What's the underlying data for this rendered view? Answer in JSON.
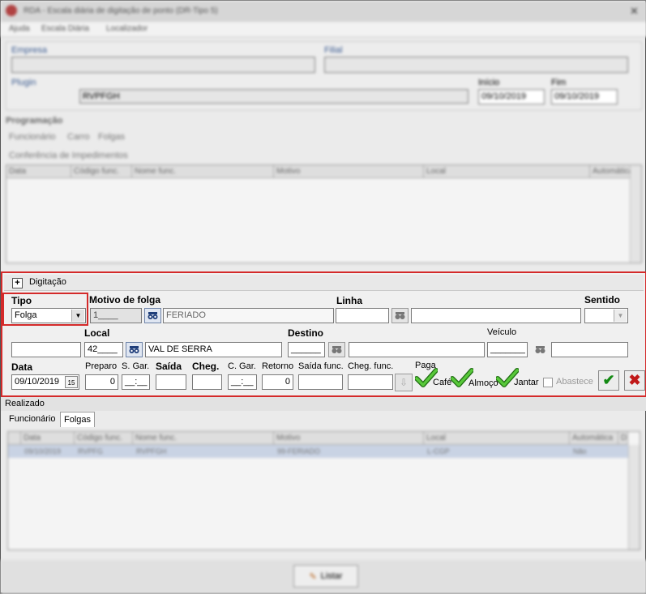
{
  "window": {
    "title": "RDA - Escala diária de digitação de ponto (DR-Tipo 5)",
    "menu": [
      "Ajuda",
      "Escala Diária",
      "Localizador"
    ]
  },
  "top": {
    "labels": [
      "Empresa",
      "Filial",
      "Plugin",
      "Início",
      "Fim"
    ],
    "values": [
      "RVPFGH",
      "09/10/2019",
      "09/10/2019"
    ]
  },
  "programacao": {
    "section_label": "Programação",
    "toggles": [
      "Funcionário",
      "Carro",
      "Folgas",
      "Conferência de Impedimentos"
    ],
    "grid_headers": [
      "Data",
      "Código func.",
      "Nome func.",
      "Motivo",
      "Local",
      "Automática"
    ]
  },
  "digitacao": {
    "header": "Digitação",
    "expand": "+",
    "tipo_label": "Tipo",
    "tipo_value": "Folga",
    "motivo_label": "Motivo de folga",
    "motivo_code": "1____",
    "motivo_desc": "FERIADO",
    "linha_label": "Linha",
    "sentido_label": "Sentido",
    "local_label": "Local",
    "local_code": "42____",
    "local_desc": "VAL DE SERRA",
    "destino_label": "Destino",
    "destino_code": "______",
    "veiculo_label": "Veículo",
    "veiculo_code": "_______",
    "data_label": "Data",
    "data_value": "09/10/2019",
    "preparo_label": "Preparo",
    "preparo_value": "0",
    "sgar_label": "S. Gar.",
    "sgar_value": "__:__",
    "saida_label": "Saída",
    "cheg_label": "Cheg.",
    "cgar_label": "C. Gar.",
    "cgar_value": "__:__",
    "retorno_label": "Retorno",
    "retorno_value": "0",
    "saida_func_label": "Saída func.",
    "cheg_func_label": "Cheg. func.",
    "paga_label": "Paga",
    "cafe_label": "Café",
    "almoco_label": "Almoço",
    "jantar_label": "Jantar",
    "abastece_label": "Abastece"
  },
  "realizado": {
    "section_label": "Realizado",
    "tabs": [
      "Funcionário",
      "Folgas"
    ],
    "grid_headers": [
      "Data",
      "Código func.",
      "Nome func.",
      "Motivo",
      "Local",
      "Automática",
      "D"
    ],
    "row": [
      "09/10/2019",
      "RVPFG",
      "RVPFGH",
      "99-FERIADO",
      "L-CGP",
      "Não"
    ]
  },
  "footer": {
    "button": "Listar"
  },
  "colors": {
    "highlight": "#d42a2a",
    "check_green": "#2e9b1a",
    "cancel_red": "#c01818"
  }
}
